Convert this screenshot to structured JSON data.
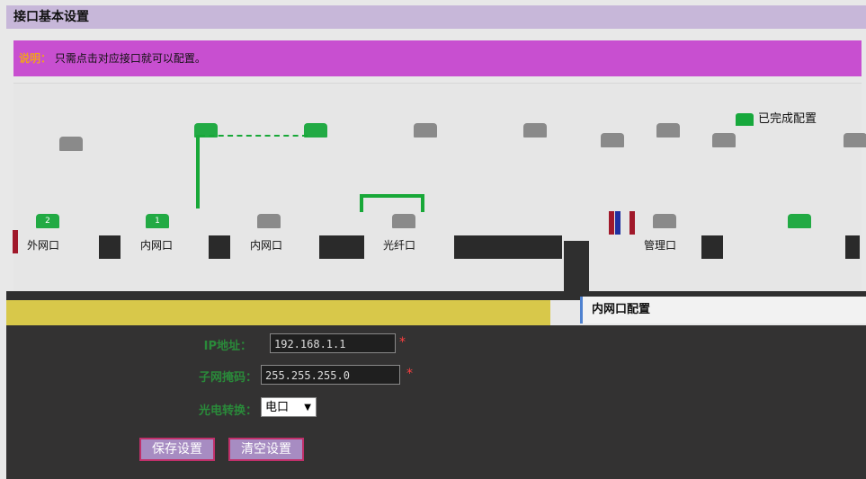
{
  "header": {
    "title": "接口基本设置"
  },
  "notice": {
    "label": "说明",
    "text": "只需点击对应接口就可以配置。"
  },
  "legend": {
    "done_label": "已完成配置"
  },
  "ports": [
    {
      "label": "外网口",
      "status": "done",
      "num": "2"
    },
    {
      "label": "内网口",
      "status": "done",
      "num": "1"
    },
    {
      "label": "内网口",
      "status": "todo",
      "num": ""
    },
    {
      "label": "光纤口",
      "status": "todo",
      "num": ""
    },
    {
      "label": "管理口",
      "status": "todo",
      "num": ""
    },
    {
      "label": "",
      "status": "done",
      "num": ""
    }
  ],
  "section": {
    "title": "内网口配置"
  },
  "form": {
    "ip_label": "IP地址：",
    "ip_value": "192.168.1.1",
    "mask_label": "子网掩码：",
    "mask_value": "255.255.255.0",
    "media_label": "光电转换：",
    "media_value": "电口",
    "required_mark": "*"
  },
  "buttons": {
    "save": "保存设置",
    "clear": "清空设置"
  },
  "colors": {
    "accent": "#c84fd0",
    "done": "#22aa44",
    "yellow": "#d8c84a"
  }
}
